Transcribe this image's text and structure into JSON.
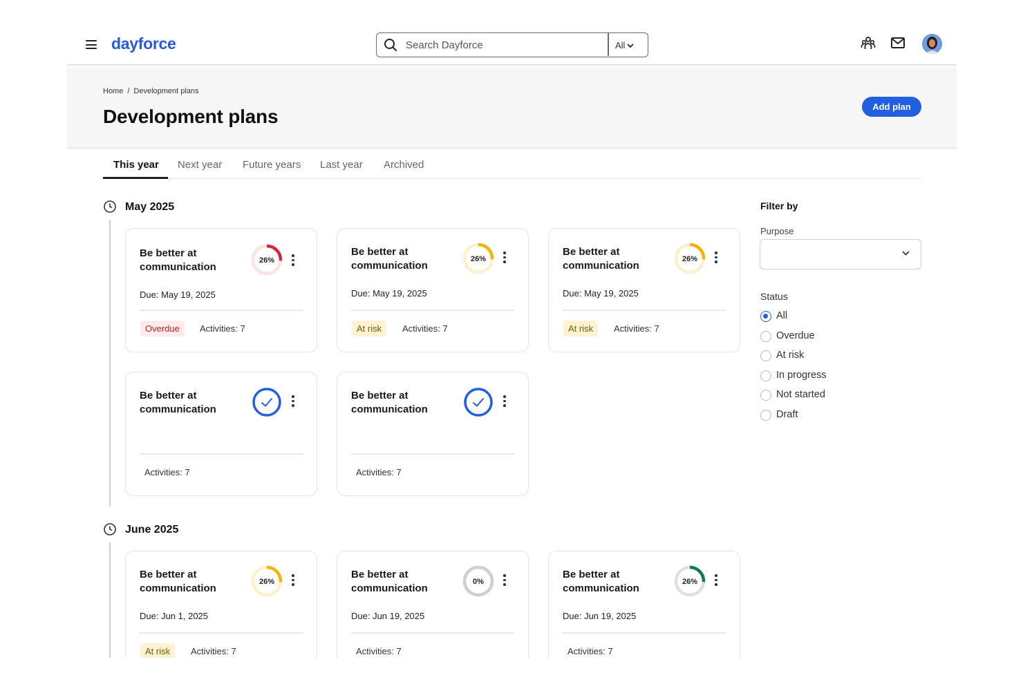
{
  "app": {
    "logo": "dayforce",
    "search_placeholder": "Search Dayforce",
    "search_scope": "All"
  },
  "breadcrumb": {
    "home": "Home",
    "separator": "/",
    "current": "Development plans"
  },
  "page": {
    "title": "Development plans",
    "add_button": "Add plan"
  },
  "tabs": [
    {
      "label": "This year",
      "active": true
    },
    {
      "label": "Next year"
    },
    {
      "label": "Future years"
    },
    {
      "label": "Last year"
    },
    {
      "label": "Archived"
    }
  ],
  "groups": [
    {
      "month": "May 2025",
      "cards": [
        {
          "title": "Be better at communication",
          "due": "Due: May 19, 2025",
          "progress_label": "26%",
          "progress": 26,
          "ring_color": "#d8263a",
          "badge": "Overdue",
          "badge_type": "overdue",
          "activities": "Activities: 7"
        },
        {
          "title": "Be better at communication",
          "due": "Due: May 19, 2025",
          "progress_label": "26%",
          "progress": 26,
          "ring_color": "#f4b400",
          "badge": "At risk",
          "badge_type": "atrisk",
          "activities": "Activities: 7"
        },
        {
          "title": "Be better at communication",
          "due": "Due: May 19, 2025",
          "progress_label": "26%",
          "progress": 26,
          "ring_color": "#f4b400",
          "badge": "At risk",
          "badge_type": "atrisk",
          "activities": "Activities: 7"
        },
        {
          "title": "Be better at communication",
          "due": "",
          "completed": true,
          "badge": "",
          "activities": "Activities: 7"
        },
        {
          "title": "Be better at communication",
          "due": "",
          "completed": true,
          "badge": "",
          "activities": "Activities: 7"
        }
      ]
    },
    {
      "month": "June 2025",
      "cards": [
        {
          "title": "Be better at communication",
          "due": "Due: Jun 1, 2025",
          "progress_label": "26%",
          "progress": 26,
          "ring_color": "#f4b400",
          "badge": "At risk",
          "badge_type": "atrisk",
          "activities": "Activities: 7"
        },
        {
          "title": "Be better at communication",
          "due": "Due: Jun 19, 2025",
          "progress_label": "0%",
          "progress": 0,
          "ring_color": "#bdbdbd",
          "badge": "",
          "activities": "Activities: 7"
        },
        {
          "title": "Be better at communication",
          "due": "Due: Jun 19, 2025",
          "progress_label": "26%",
          "progress": 26,
          "ring_color": "#0f7b4f",
          "badge": "",
          "activities": "Activities: 7"
        }
      ]
    }
  ],
  "filters": {
    "title": "Filter by",
    "purpose_label": "Purpose",
    "purpose_value": "",
    "status_label": "Status",
    "status_options": [
      {
        "label": "All",
        "checked": true
      },
      {
        "label": "Overdue"
      },
      {
        "label": "At risk"
      },
      {
        "label": "In progress"
      },
      {
        "label": "Not started"
      },
      {
        "label": "Draft"
      }
    ]
  },
  "icons": {
    "menu": "hamburger-icon",
    "search": "search-icon",
    "people": "team-icon",
    "mail": "mail-icon",
    "clock": "clock-icon",
    "more": "kebab-menu-icon",
    "check": "check-icon",
    "dropdown": "chevron-down-icon"
  },
  "colors": {
    "brand": "#2a59d9",
    "primary_button": "#1f5fe0"
  }
}
